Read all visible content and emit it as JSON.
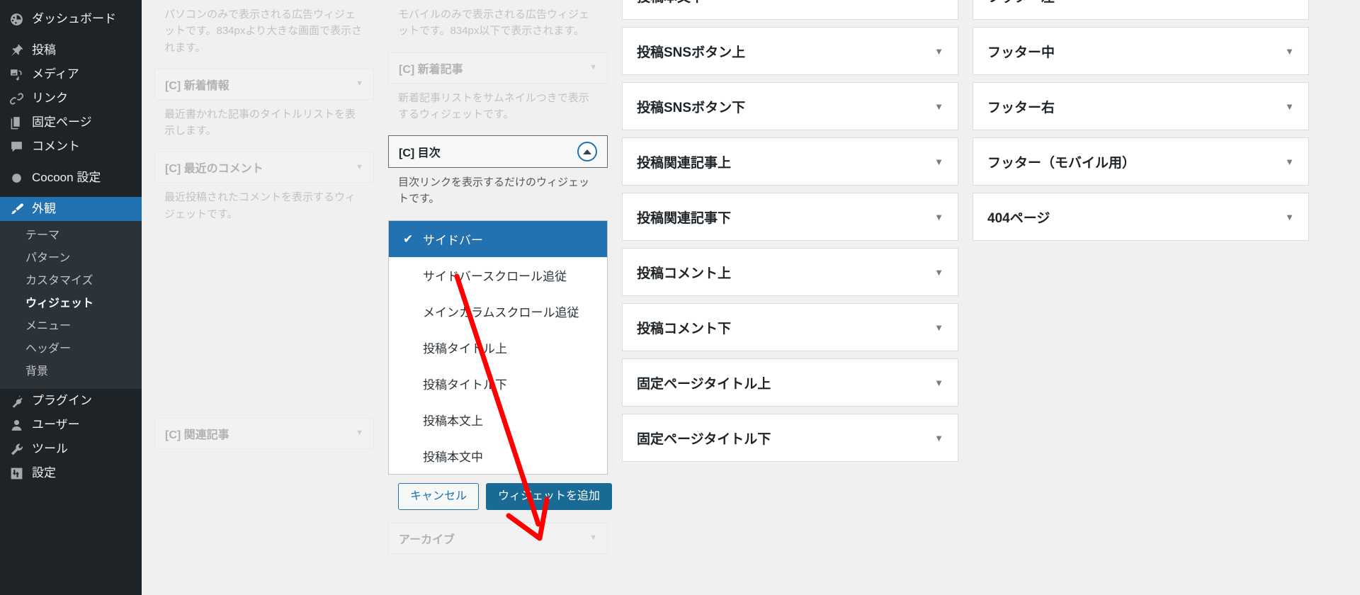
{
  "sidebar": {
    "items": [
      {
        "label": "ダッシュボード",
        "icon": "dashboard-icon"
      },
      {
        "label": "投稿",
        "icon": "pin-icon"
      },
      {
        "label": "メディア",
        "icon": "media-icon"
      },
      {
        "label": "リンク",
        "icon": "link-icon"
      },
      {
        "label": "固定ページ",
        "icon": "pages-icon"
      },
      {
        "label": "コメント",
        "icon": "comment-icon"
      },
      {
        "label": "Cocoon 設定",
        "icon": "circle-icon"
      },
      {
        "label": "外観",
        "icon": "brush-icon"
      },
      {
        "label": "プラグイン",
        "icon": "plug-icon"
      },
      {
        "label": "ユーザー",
        "icon": "user-icon"
      },
      {
        "label": "ツール",
        "icon": "wrench-icon"
      },
      {
        "label": "設定",
        "icon": "sliders-icon"
      }
    ],
    "appearance_submenu": [
      {
        "label": "テーマ",
        "current": false
      },
      {
        "label": "パターン",
        "current": false
      },
      {
        "label": "カスタマイズ",
        "current": false
      },
      {
        "label": "ウィジェット",
        "current": true
      },
      {
        "label": "メニュー",
        "current": false
      },
      {
        "label": "ヘッダー",
        "current": false
      },
      {
        "label": "背景",
        "current": false
      }
    ]
  },
  "available_widgets": {
    "column1": [
      {
        "description": "パソコンのみで表示される広告ウィジェットです。834pxより大きな画面で表示されます。",
        "title": ""
      },
      {
        "title": "[C] 新着情報",
        "description": "最近書かれた記事のタイトルリストを表示します。",
        "caret": "▼"
      },
      {
        "title": "[C] 最近のコメント",
        "description": "最近投稿されたコメントを表示するウィジェットです。",
        "caret": "▼"
      },
      {
        "title": "[C] 関連記事",
        "description": "",
        "caret": "▼"
      }
    ],
    "column2": [
      {
        "description": "モバイルのみで表示される広告ウィジェットです。834px以下で表示されます。",
        "title": ""
      },
      {
        "title": "[C] 新着記事",
        "description": "新着記事リストをサムネイルつきで表示するウィジェットです。",
        "caret": "▼"
      },
      {
        "title": "[C] 目次",
        "description": "目次リンクを表示するだけのウィジェットです。",
        "active": true
      },
      {
        "title": "アーカイブ",
        "description": "",
        "caret": "▼"
      }
    ]
  },
  "chooser": {
    "options": [
      {
        "label": "サイドバー",
        "selected": true
      },
      {
        "label": "サイドバースクロール追従",
        "selected": false
      },
      {
        "label": "メインカラムスクロール追従",
        "selected": false
      },
      {
        "label": "投稿タイトル上",
        "selected": false
      },
      {
        "label": "投稿タイトル下",
        "selected": false
      },
      {
        "label": "投稿本文上",
        "selected": false
      },
      {
        "label": "投稿本文中",
        "selected": false
      }
    ],
    "check_glyph": "✔",
    "cancel_label": "キャンセル",
    "add_label": "ウィジェットを追加"
  },
  "widget_areas": {
    "column3": [
      {
        "label": "投稿本文下",
        "caret": "▼"
      },
      {
        "label": "投稿SNSボタン上",
        "caret": "▼"
      },
      {
        "label": "投稿SNSボタン下",
        "caret": "▼"
      },
      {
        "label": "投稿関連記事上",
        "caret": "▼"
      },
      {
        "label": "投稿関連記事下",
        "caret": "▼"
      },
      {
        "label": "投稿コメント上",
        "caret": "▼"
      },
      {
        "label": "投稿コメント下",
        "caret": "▼"
      },
      {
        "label": "固定ページタイトル上",
        "caret": "▼"
      },
      {
        "label": "固定ページタイトル下",
        "caret": "▼"
      }
    ],
    "column4": [
      {
        "label": "フッター左",
        "caret": "▼"
      },
      {
        "label": "フッター中",
        "caret": "▼"
      },
      {
        "label": "フッター右",
        "caret": "▼"
      },
      {
        "label": "フッター（モバイル用）",
        "caret": "▼"
      },
      {
        "label": "404ページ",
        "caret": "▼"
      }
    ]
  },
  "colors": {
    "admin_bg": "#1d2327",
    "admin_submenu_bg": "#2c3338",
    "accent": "#2271b1",
    "primary_button": "#1a6a96",
    "annotation": "#ff0000",
    "page_bg": "#f0f0f1"
  }
}
